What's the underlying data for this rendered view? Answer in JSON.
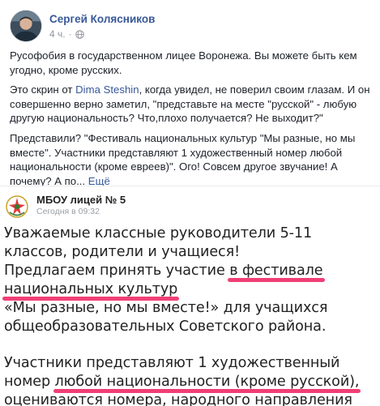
{
  "post": {
    "author": "Сергей Колясников",
    "time": "4 ч.",
    "separator": "·",
    "privacy_icon": "globe-icon",
    "paragraphs": {
      "p1": "Русофобия в государственном лицее Воронежа. Вы можете быть кем угодно, кроме русских.",
      "p2_before": "Это скрин от ",
      "p2_link": "Dima Steshin",
      "p2_after": ", когда увидел, не поверил своим глазам. И он совершенно верно заметил, \"представьте на месте \"русской\" - любую другую национальность? Что,плохо получается? Не выходит?\"",
      "p3": "Представили? \"Фестиваль национальных культур \"Мы разные, но мы вместе\". Участники представляют 1 художественный номер любой национальности (кроме евреев)\". Ого! Совсем другое звучание! А почему? А по... ",
      "more": "Ещё"
    }
  },
  "shared_image": {
    "source_name": "МБОУ лицей № 5",
    "source_time": "Сегодня в 09:32",
    "lines": {
      "l1": "Уважаемые классные руководители 5-11",
      "l2": "классов, родители и  учащиеся!",
      "l3a": "Предлагаем принять участие ",
      "l3b": "в  фестивале",
      "l4": "национальных культур",
      "l5": "«Мы разные, но мы вместе!» для учащихся",
      "l6": "общеобразовательных Советского района.",
      "l7": "Участники представляют 1 художественный",
      "l8a": "номер ",
      "l8b": "любой национальности (кроме русской),",
      "l9": "оцениваются номера, народного направления"
    }
  },
  "colors": {
    "link": "#385898",
    "highlight": "#ef2f6a",
    "meta": "#90949c"
  }
}
